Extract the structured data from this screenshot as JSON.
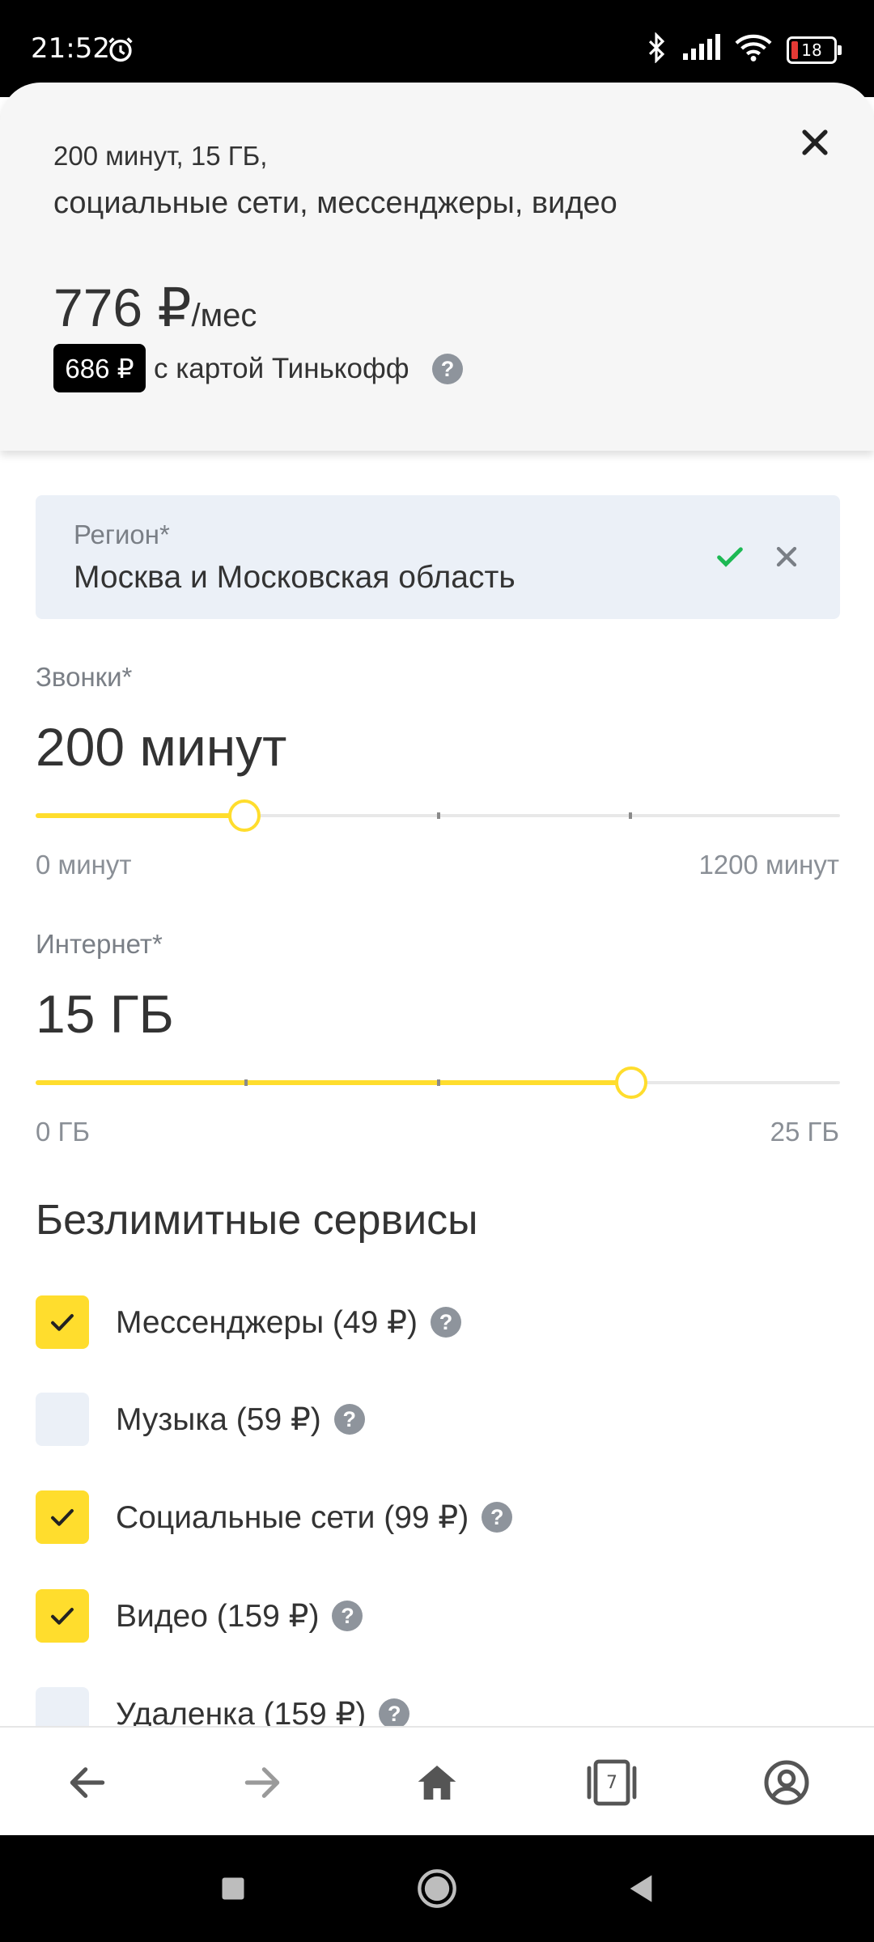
{
  "status_bar": {
    "time": "21:52",
    "battery": "18"
  },
  "summary_card": {
    "line1": "200 минут, 15 ГБ,",
    "line2": "социальные сети, мессенджеры, видео",
    "price": "776 ₽",
    "price_unit": "/мес",
    "card_price": "686 ₽",
    "card_text": "с картой Тинькофф",
    "help": "?"
  },
  "region": {
    "label": "Регион*",
    "value": "Москва и Московская область"
  },
  "calls": {
    "label": "Звонки*",
    "value": "200 минут",
    "min_label": "0 минут",
    "max_label": "1200 минут",
    "level_fraction": 0.26
  },
  "internet": {
    "label": "Интернет*",
    "value": "15 ГБ",
    "min_label": "0 ГБ",
    "max_label": "25 ГБ",
    "level_fraction": 0.74
  },
  "services": {
    "title": "Безлимитные сервисы",
    "items": [
      {
        "label": "Мессенджеры (49 ₽)",
        "checked": true,
        "help": "?"
      },
      {
        "label": "Музыка (59 ₽)",
        "checked": false,
        "help": "?"
      },
      {
        "label": "Социальные сети (99 ₽)",
        "checked": true,
        "help": "?"
      },
      {
        "label": "Видео (159 ₽)",
        "checked": true,
        "help": "?"
      },
      {
        "label": "Удаленка (159 ₽)",
        "checked": false,
        "help": "?"
      }
    ]
  },
  "browser_nav": {
    "tabs_count": "7"
  },
  "colors": {
    "accent": "#ffdd2d",
    "field_bg": "#ebf0f7",
    "check_green": "#1db954"
  }
}
